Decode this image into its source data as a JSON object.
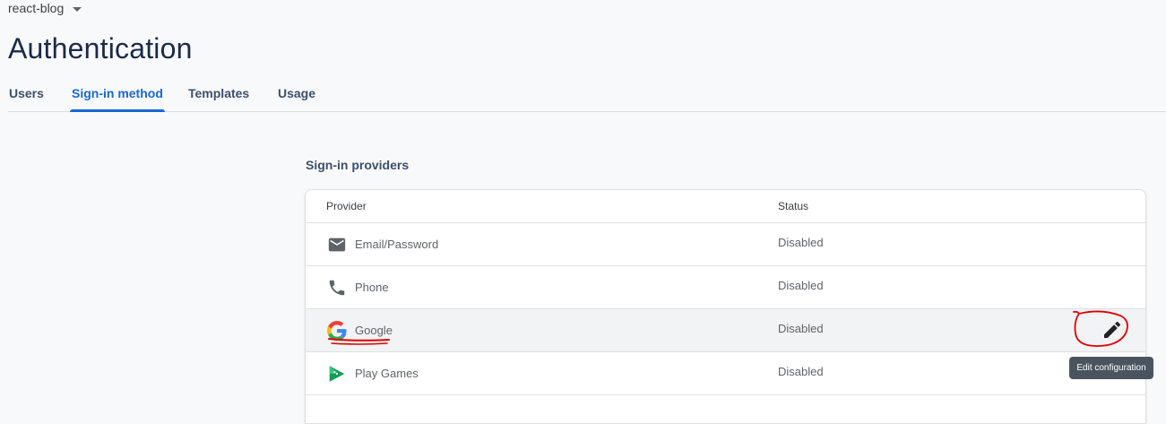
{
  "header": {
    "project_name": "react-blog",
    "page_title": "Authentication"
  },
  "tabs": [
    {
      "label": "Users",
      "active": false
    },
    {
      "label": "Sign-in method",
      "active": true
    },
    {
      "label": "Templates",
      "active": false
    },
    {
      "label": "Usage",
      "active": false
    }
  ],
  "providers": {
    "section_title": "Sign-in providers",
    "columns": {
      "provider": "Provider",
      "status": "Status"
    },
    "rows": [
      {
        "name": "Email/Password",
        "status": "Disabled",
        "icon": "email-icon"
      },
      {
        "name": "Phone",
        "status": "Disabled",
        "icon": "phone-icon"
      },
      {
        "name": "Google",
        "status": "Disabled",
        "icon": "google-icon"
      },
      {
        "name": "Play Games",
        "status": "Disabled",
        "icon": "play-games-icon"
      }
    ]
  },
  "tooltip": "Edit configuration",
  "colors": {
    "accent": "#1967d2",
    "annotation": "#e00000"
  }
}
